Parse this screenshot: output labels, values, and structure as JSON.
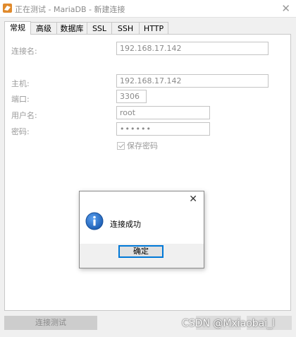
{
  "window": {
    "title": "正在测试 - MariaDB - 新建连接",
    "close_glyph": "✕"
  },
  "tabs": [
    "常规",
    "高级",
    "数据库",
    "SSL",
    "SSH",
    "HTTP"
  ],
  "form": {
    "connection_name": {
      "label": "连接名:",
      "value": "192.168.17.142"
    },
    "host": {
      "label": "主机:",
      "value": "192.168.17.142"
    },
    "port": {
      "label": "端口:",
      "value": "3306"
    },
    "username": {
      "label": "用户名:",
      "value": "root"
    },
    "password": {
      "label": "密码:",
      "value": "••••••"
    },
    "save_password": {
      "label": "保存密码",
      "checked": true
    }
  },
  "footer": {
    "test_button": "连接测试"
  },
  "dialog": {
    "close_glyph": "✕",
    "message": "连接成功",
    "ok_button": "确定",
    "icon": "info-icon"
  },
  "watermark": "CSDN @Mxiaobai_l",
  "colors": {
    "accent": "#0078d7",
    "info_icon": "#1e5fb4"
  }
}
